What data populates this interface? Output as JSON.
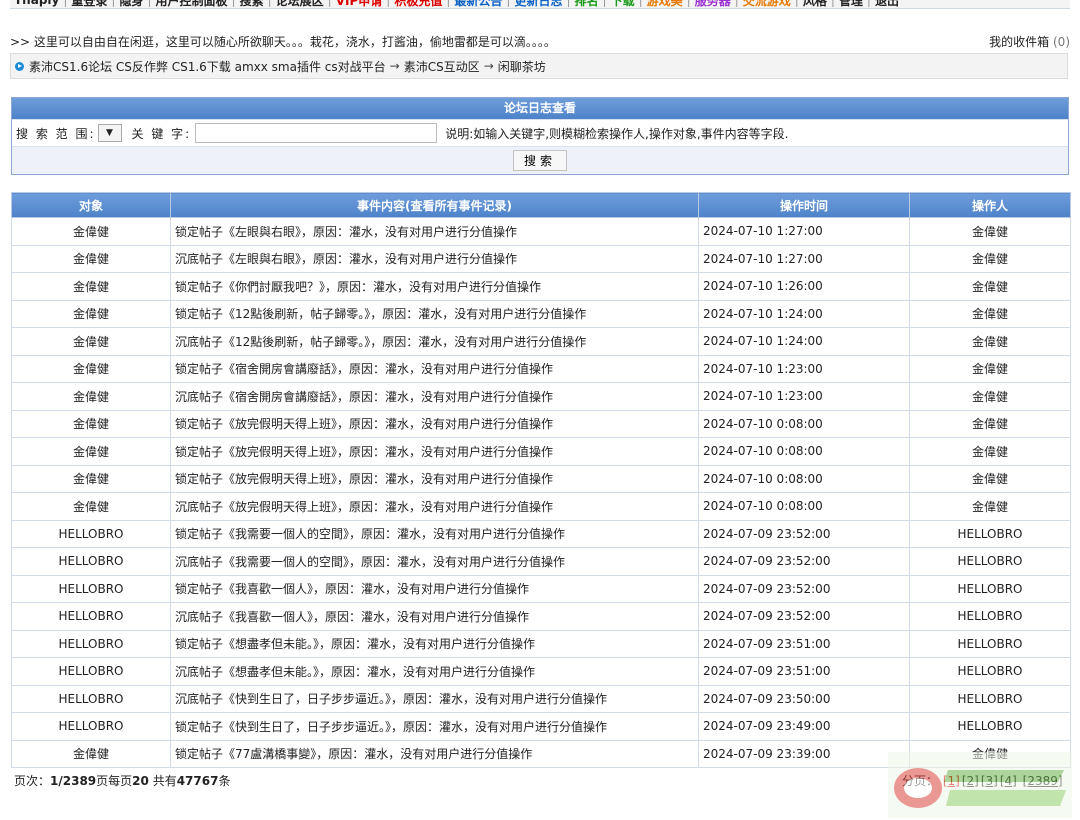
{
  "nav": {
    "items": [
      {
        "label": "Thaply",
        "color": "default"
      },
      {
        "label": "重登录",
        "color": "default"
      },
      {
        "label": "隐身",
        "color": "default"
      },
      {
        "label": "用户控制面板",
        "color": "default"
      },
      {
        "label": "搜索",
        "color": "default"
      },
      {
        "label": "论坛展区",
        "color": "default"
      },
      {
        "label": "VIP申请",
        "color": "red"
      },
      {
        "label": "积极充值",
        "color": "red"
      },
      {
        "label": "最新公告",
        "color": "blue"
      },
      {
        "label": "更新日志",
        "color": "blue"
      },
      {
        "label": "排名",
        "color": "green"
      },
      {
        "label": "下载",
        "color": "green"
      },
      {
        "label": "游戏美",
        "color": "orange"
      },
      {
        "label": "服务器",
        "color": "purple"
      },
      {
        "label": "交流游戏",
        "color": "orange"
      },
      {
        "label": "风格",
        "color": "default"
      },
      {
        "label": "管理",
        "color": "default"
      },
      {
        "label": "退出",
        "color": "default"
      }
    ]
  },
  "notice": ">> 这里可以自由自在闲逛，这里可以随心所欲聊天。。。栽花，浇水，打酱油，偷地雷都是可以滴。。。。",
  "inbox": {
    "label": "我的收件箱",
    "count": "(0)"
  },
  "breadcrumb": {
    "segment1": "素沛CS1.6论坛 CS反作弊 CS1.6下载 amxx sma插件 cs对战平台",
    "segment2": "素沛CS互动区",
    "segment3": "闲聊茶坊"
  },
  "search": {
    "title": "论坛日志查看",
    "scope_label": "搜 索 范 围:",
    "select_arrow": "▼",
    "keyword_label": "关 键 字:",
    "keyword_value": "",
    "hint": "说明:如输入关键字,则模糊检索操作人,操作对象,事件内容等字段.",
    "button": "搜索"
  },
  "table": {
    "headers": [
      "对象",
      "事件内容(查看所有事件记录)",
      "操作时间",
      "操作人"
    ],
    "rows": [
      [
        "金偉健",
        "锁定帖子《左眼與右眼》，原因：灌水，没有对用户进行分值操作",
        "2024-07-10 1:27:00",
        "金偉健"
      ],
      [
        "金偉健",
        "沉底帖子《左眼與右眼》，原因：灌水，没有对用户进行分值操作",
        "2024-07-10 1:27:00",
        "金偉健"
      ],
      [
        "金偉健",
        "锁定帖子《你們討厭我吧？》，原因：灌水，没有对用户进行分值操作",
        "2024-07-10 1:26:00",
        "金偉健"
      ],
      [
        "金偉健",
        "锁定帖子《12點後刷新，帖子歸零。》，原因：灌水，没有对用户进行分值操作",
        "2024-07-10 1:24:00",
        "金偉健"
      ],
      [
        "金偉健",
        "沉底帖子《12點後刷新，帖子歸零。》，原因：灌水，没有对用户进行分值操作",
        "2024-07-10 1:24:00",
        "金偉健"
      ],
      [
        "金偉健",
        "锁定帖子《宿舍開房會講廢話》，原因：灌水，没有对用户进行分值操作",
        "2024-07-10 1:23:00",
        "金偉健"
      ],
      [
        "金偉健",
        "沉底帖子《宿舍開房會講廢話》，原因：灌水，没有对用户进行分值操作",
        "2024-07-10 1:23:00",
        "金偉健"
      ],
      [
        "金偉健",
        "锁定帖子《放完假明天得上班》，原因：灌水，没有对用户进行分值操作",
        "2024-07-10 0:08:00",
        "金偉健"
      ],
      [
        "金偉健",
        "锁定帖子《放完假明天得上班》，原因：灌水，没有对用户进行分值操作",
        "2024-07-10 0:08:00",
        "金偉健"
      ],
      [
        "金偉健",
        "锁定帖子《放完假明天得上班》，原因：灌水，没有对用户进行分值操作",
        "2024-07-10 0:08:00",
        "金偉健"
      ],
      [
        "金偉健",
        "沉底帖子《放完假明天得上班》，原因：灌水，没有对用户进行分值操作",
        "2024-07-10 0:08:00",
        "金偉健"
      ],
      [
        "HELLOBRO",
        "锁定帖子《我需要一個人的空間》，原因：灌水，没有对用户进行分值操作",
        "2024-07-09 23:52:00",
        "HELLOBRO"
      ],
      [
        "HELLOBRO",
        "沉底帖子《我需要一個人的空間》，原因：灌水，没有对用户进行分值操作",
        "2024-07-09 23:52:00",
        "HELLOBRO"
      ],
      [
        "HELLOBRO",
        "锁定帖子《我喜歡一個人》，原因：灌水，没有对用户进行分值操作",
        "2024-07-09 23:52:00",
        "HELLOBRO"
      ],
      [
        "HELLOBRO",
        "沉底帖子《我喜歡一個人》，原因：灌水，没有对用户进行分值操作",
        "2024-07-09 23:52:00",
        "HELLOBRO"
      ],
      [
        "HELLOBRO",
        "锁定帖子《想盡孝但未能。》，原因：灌水，没有对用户进行分值操作",
        "2024-07-09 23:51:00",
        "HELLOBRO"
      ],
      [
        "HELLOBRO",
        "沉底帖子《想盡孝但未能。》，原因：灌水，没有对用户进行分值操作",
        "2024-07-09 23:51:00",
        "HELLOBRO"
      ],
      [
        "HELLOBRO",
        "沉底帖子《快到生日了，日子步步逼近。》，原因：灌水，没有对用户进行分值操作",
        "2024-07-09 23:50:00",
        "HELLOBRO"
      ],
      [
        "HELLOBRO",
        "锁定帖子《快到生日了，日子步步逼近。》，原因：灌水，没有对用户进行分值操作",
        "2024-07-09 23:49:00",
        "HELLOBRO"
      ],
      [
        "金偉健",
        "锁定帖子《77盧溝橋事變》，原因：灌水，没有对用户进行分值操作",
        "2024-07-09 23:39:00",
        "金偉健"
      ]
    ]
  },
  "pager": {
    "label": "页次：",
    "current": "1/2389",
    "per_page_prefix": "页每页",
    "per_page": "20",
    "total_prefix": " 共有",
    "total": "47767",
    "total_suffix": "条",
    "nav_label": "分页：",
    "pages": [
      "[1]",
      "[2]",
      "[3]",
      "[4]"
    ],
    "last": "[2389]"
  }
}
